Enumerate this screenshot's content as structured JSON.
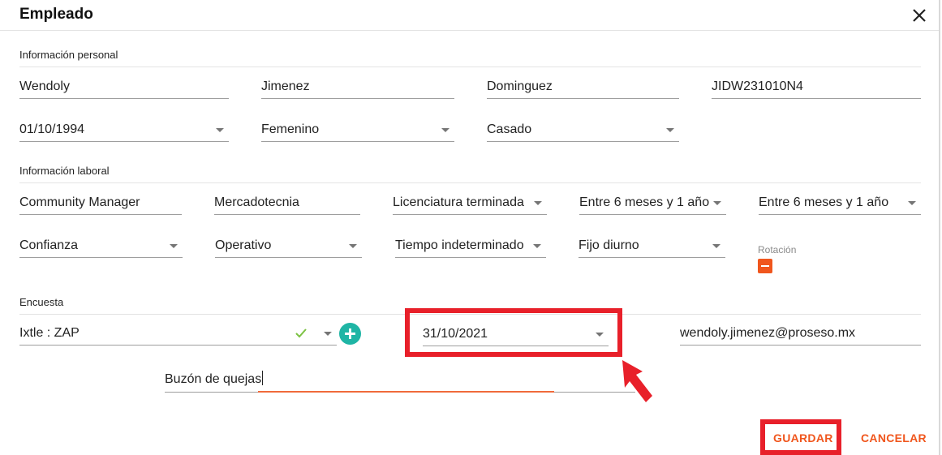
{
  "dialog": {
    "title": "Empleado",
    "close_icon": "close-icon"
  },
  "personal": {
    "heading": "Información personal",
    "nombre": "Wendoly",
    "apellido_paterno": "Jimenez",
    "apellido_materno": "Dominguez",
    "rfc": "JIDW231010N4",
    "fecha_nacimiento": "01/10/1994",
    "sexo": "Femenino",
    "estado_civil": "Casado"
  },
  "laboral": {
    "heading": "Información laboral",
    "puesto": "Community Manager",
    "area": "Mercadotecnia",
    "escolaridad": "Licenciatura terminada",
    "antiguedad_puesto": "Entre 6 meses y 1 año",
    "antiguedad_empresa": "Entre 6 meses y 1 año",
    "tipo_personal": "Confianza",
    "tipo_puesto": "Operativo",
    "tipo_contratacion": "Tiempo indeterminado",
    "jornada": "Fijo diurno",
    "rotacion_label": "Rotación"
  },
  "encuesta": {
    "heading": "Encuesta",
    "encuesta_value": "Ixtle : ZAP",
    "fecha": "31/10/2021",
    "email": "wendoly.jimenez@proseso.mx",
    "buzon": "Buzón de quejas"
  },
  "actions": {
    "save_label": "GUARDAR",
    "cancel_label": "CANCELAR"
  },
  "colors": {
    "accent": "#f0561d",
    "teal": "#1fb5a5",
    "highlight": "#e8202a",
    "check": "#7cc243"
  }
}
